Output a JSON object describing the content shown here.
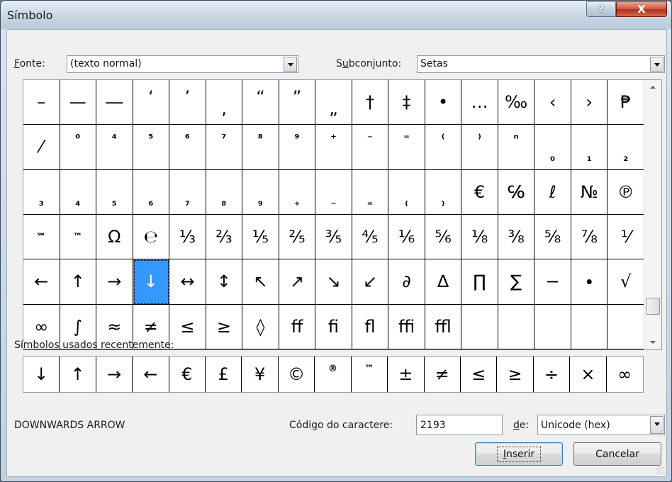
{
  "window": {
    "title": "Símbolo",
    "help_label": "?",
    "close_label": "X"
  },
  "font": {
    "label_pre": "",
    "label_u": "F",
    "label_post": "onte:",
    "value": "(texto normal)"
  },
  "subset": {
    "label_pre": "S",
    "label_u": "u",
    "label_post": "bconjunto:",
    "value": "Setas"
  },
  "symbol_grid": {
    "selected": "↓",
    "rows": [
      [
        "–",
        "—",
        "―",
        "‘",
        "’",
        "‚",
        "“",
        "”",
        "„",
        "†",
        "‡",
        "•",
        "…",
        "‰",
        "‹",
        "›",
        "₱"
      ],
      [
        "⁄",
        "⁰",
        "⁴",
        "⁵",
        "⁶",
        "⁷",
        "⁸",
        "⁹",
        "⁺",
        "⁻",
        "⁼",
        "⁽",
        "⁾",
        "ⁿ",
        "₀",
        "₁",
        "₂"
      ],
      [
        "₃",
        "₄",
        "₅",
        "₆",
        "₇",
        "₈",
        "₉",
        "₊",
        "₋",
        "₌",
        "₍",
        "₎",
        "€",
        "℅",
        "ℓ",
        "№",
        "℗"
      ],
      [
        "℠",
        "™",
        "Ω",
        "℮",
        "⅓",
        "⅔",
        "⅕",
        "⅖",
        "⅗",
        "⅘",
        "⅙",
        "⅚",
        "⅛",
        "⅜",
        "⅝",
        "⅞",
        "⅟"
      ],
      [
        "←",
        "↑",
        "→",
        "↓",
        "↔",
        "↕",
        "↖",
        "↗",
        "↘",
        "↙",
        "∂",
        "∆",
        "∏",
        "∑",
        "−",
        "∙",
        "√"
      ],
      [
        "∞",
        "∫",
        "≈",
        "≠",
        "≤",
        "≥",
        "◊",
        "ﬀ",
        "ﬁ",
        "ﬂ",
        "ﬃ",
        "ﬄ",
        "",
        "",
        "",
        "",
        ""
      ]
    ]
  },
  "recent": {
    "label_pre": "Sí",
    "label_u": "m",
    "label_post": "bolos usados recentemente:",
    "symbols": [
      "↓",
      "↑",
      "→",
      "←",
      "€",
      "£",
      "¥",
      "©",
      "®",
      "™",
      "±",
      "≠",
      "≤",
      "≥",
      "÷",
      "×",
      "∞"
    ]
  },
  "char_name": "DOWNWARDS ARROW",
  "code": {
    "label_pre": "Códi",
    "label_u": "g",
    "label_post": "o do caractere:",
    "value": "2193"
  },
  "from": {
    "label_u": "d",
    "label_post": "e:",
    "value": "Unicode (hex)"
  },
  "buttons": {
    "insert_u": "I",
    "insert_post": "nserir",
    "cancel": "Cancelar"
  }
}
